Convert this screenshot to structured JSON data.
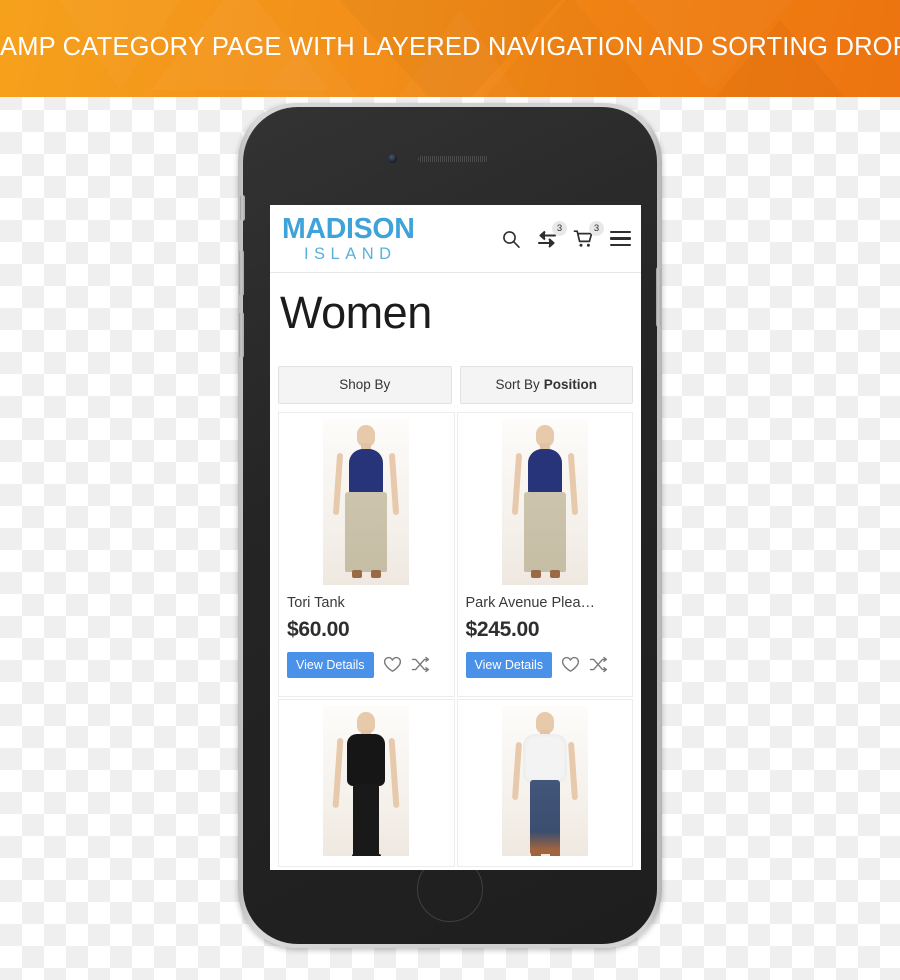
{
  "banner": {
    "title": "AMP CATEGORY PAGE WITH LAYERED NAVIGATION AND SORTING DROPDOWN",
    "color": "#f2901a",
    "text_color": "#ffffff"
  },
  "device": {
    "type": "smartphone",
    "frame_color": "#cfcfcf",
    "body_color": "#252525"
  },
  "screen": {
    "header": {
      "logo_main": "MADISON",
      "logo_sub": "ISLAND",
      "logo_color": "#3fa2d8",
      "icons": [
        {
          "name": "search-icon",
          "badge": null
        },
        {
          "name": "compare-icon",
          "badge": "3"
        },
        {
          "name": "cart-icon",
          "badge": "3"
        },
        {
          "name": "menu-icon",
          "badge": null
        }
      ]
    },
    "page_title": "Women",
    "toolbar": {
      "shop_by_label": "Shop By",
      "sort_by_label": "Sort By",
      "sort_by_value": "Position"
    },
    "products": [
      {
        "name": "Tori Tank",
        "price": "$60.00",
        "button_label": "View Details",
        "button_color": "#4a91ea",
        "wishlist_icon": "heart-icon",
        "compare_icon": "shuffle-icon",
        "image": {
          "top_color": "#27347a",
          "bottom_color": "#cdc4ad",
          "shoe_color": "#9a6a46"
        }
      },
      {
        "name": "Park Avenue Plea…",
        "price": "$245.00",
        "button_label": "View Details",
        "button_color": "#4a91ea",
        "wishlist_icon": "heart-icon",
        "compare_icon": "shuffle-icon",
        "image": {
          "top_color": "#27347a",
          "bottom_color": "#cdc4ad",
          "shoe_color": "#9a6a46"
        }
      },
      {
        "name": "",
        "price": "",
        "button_label": "",
        "button_color": "#4a91ea",
        "wishlist_icon": "heart-icon",
        "compare_icon": "shuffle-icon",
        "image": {
          "top_color": "#161616",
          "bottom_color": "#191919",
          "shoe_color": "#1a1a1a"
        }
      },
      {
        "name": "",
        "price": "",
        "button_label": "",
        "button_color": "#4a91ea",
        "wishlist_icon": "heart-icon",
        "compare_icon": "shuffle-icon",
        "image": {
          "top_color": "#f3f3f3",
          "bottom_color": "#42567a",
          "shoe_color": "#a0643f"
        }
      }
    ]
  }
}
